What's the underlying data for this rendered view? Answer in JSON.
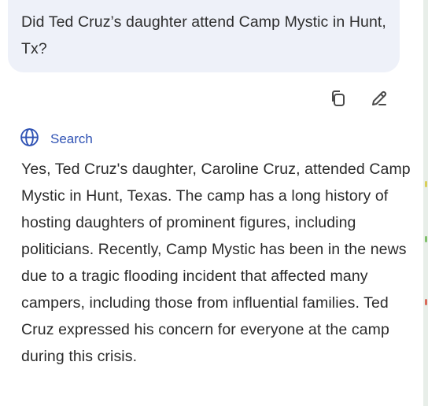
{
  "user_message": {
    "text": "Did Ted Cruz’s daughter attend Camp Mystic in Hunt, Tx?"
  },
  "message_actions": {
    "copy_icon": "copy-icon",
    "edit_icon": "pencil-icon"
  },
  "assistant_message": {
    "source_label": "Search",
    "source_icon": "globe-icon",
    "answer": "Yes, Ted Cruz's daughter, Caroline Cruz, attended Camp Mystic in Hunt, Texas. The camp has a long history of hosting daughters of prominent figures, including politicians. Recently, Camp Mystic has been in the news due to a tragic flooding incident that affected many campers, including those from influential families. Ted Cruz expressed his concern for everyone at the camp during this crisis."
  },
  "colors": {
    "bubble_bg": "#eef1f9",
    "accent": "#2f52b4",
    "text": "#2b2b2b",
    "icon": "#4a4a4a"
  }
}
